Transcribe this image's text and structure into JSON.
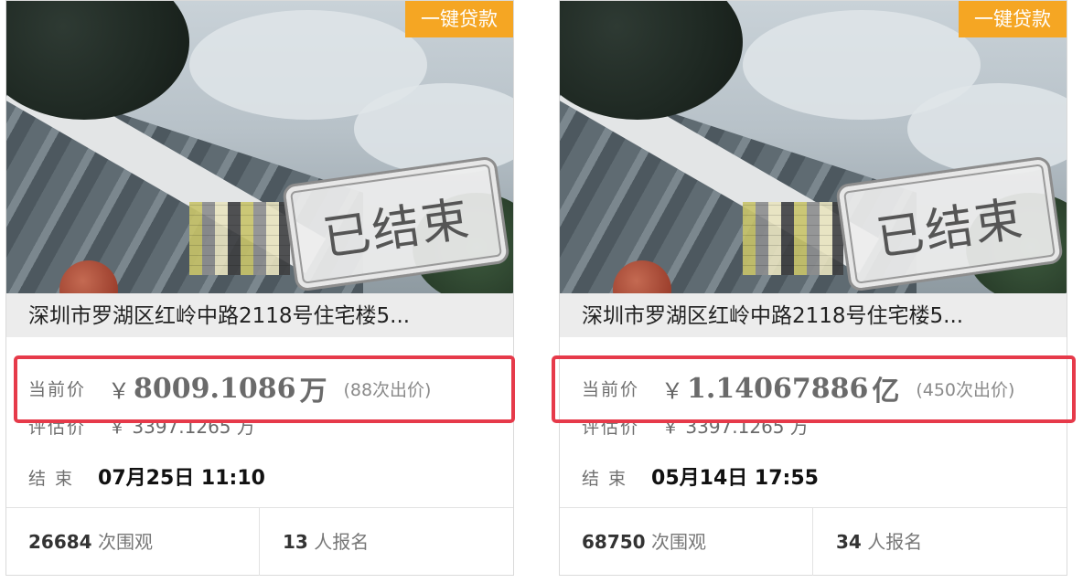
{
  "cards": [
    {
      "badge": "一键贷款",
      "stamp": "已结束",
      "title": "深圳市罗湖区红岭中路2118号住宅楼5...",
      "price_label": "当前价",
      "currency": "￥",
      "price_amount": "8009.1086",
      "price_unit": "万",
      "bids": "(88次出价)",
      "est_label": "评估价",
      "est_value": "￥ 3397.1265 万",
      "end_label": "结  束",
      "end_value": "07月25日 11:10",
      "views_count": "26684",
      "views_label": "次围观",
      "signups_count": "13",
      "signups_label": "人报名"
    },
    {
      "badge": "一键贷款",
      "stamp": "已结束",
      "title": "深圳市罗湖区红岭中路2118号住宅楼5...",
      "price_label": "当前价",
      "currency": "￥",
      "price_amount": "1.14067886",
      "price_unit": "亿",
      "bids": "(450次出价)",
      "est_label": "评估价",
      "est_value": "￥ 3397.1265 万",
      "end_label": "结  束",
      "end_value": "05月14日 17:55",
      "views_count": "68750",
      "views_label": "次围观",
      "signups_count": "34",
      "signups_label": "人报名"
    }
  ],
  "colors": {
    "badge": "#f5a623",
    "highlight": "#e63a4a"
  }
}
